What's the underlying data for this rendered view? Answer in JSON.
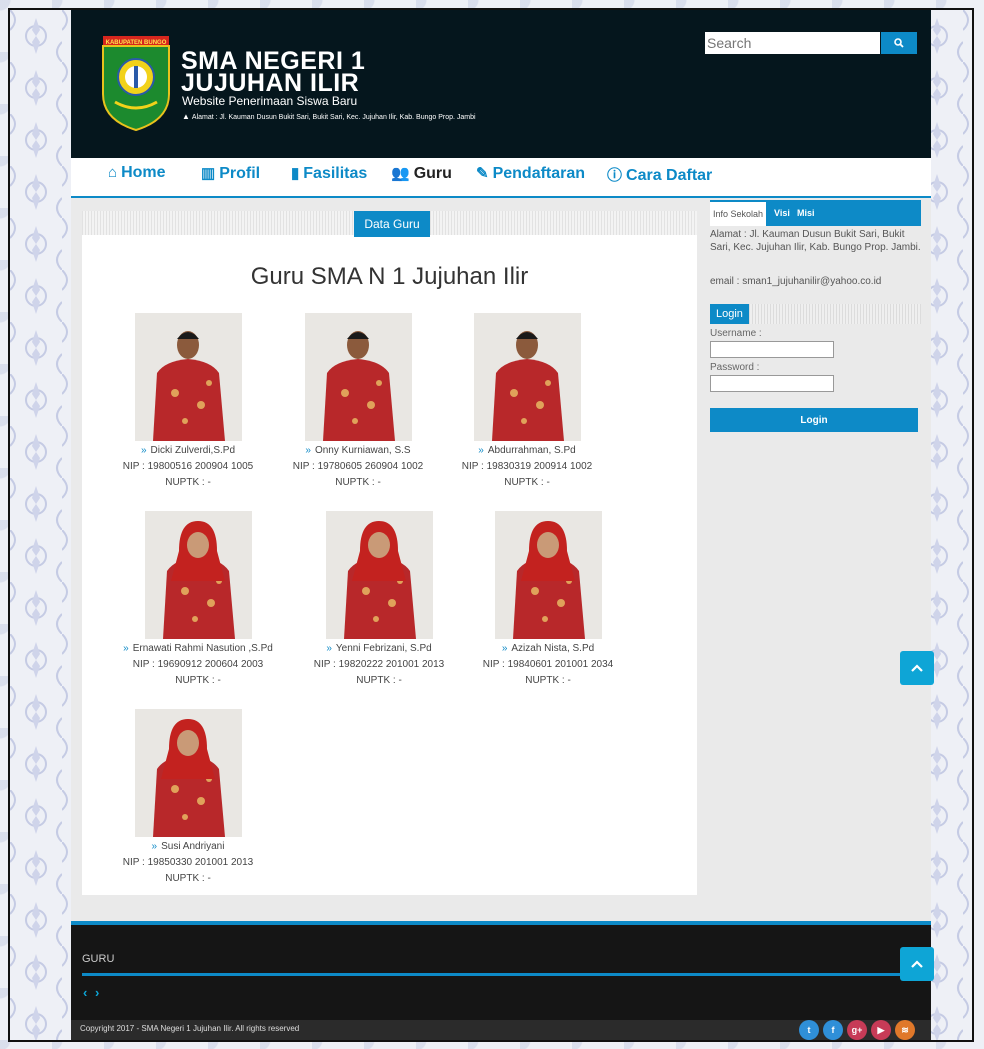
{
  "header": {
    "title_line1": "SMA NEGERI 1",
    "title_line2": "JUJUHAN ILIR",
    "subtitle": "Website Penerimaan Siswa Baru",
    "address": "Alamat : Jl. Kauman Dusun Bukit Sari, Bukit Sari, Kec. Jujuhan Ilir, Kab. Bungo Prop. Jambi",
    "logo_text": "KABUPATEN BUNGO",
    "search_placeholder": "Search",
    "search_icon": "search-icon"
  },
  "nav": [
    {
      "label": "Home",
      "icon": "home-icon",
      "active": false
    },
    {
      "label": "Profil",
      "icon": "institution-icon",
      "active": false
    },
    {
      "label": "Fasilitas",
      "icon": "bookmark-icon",
      "active": false
    },
    {
      "label": "Guru",
      "icon": "users-icon",
      "active": true
    },
    {
      "label": "Pendaftaran",
      "icon": "edit-icon",
      "active": false
    },
    {
      "label": "Cara Daftar",
      "icon": "info-icon",
      "active": false
    }
  ],
  "main": {
    "tab_label": "Data Guru",
    "title": "Guru SMA N 1 Jujuhan Ilir",
    "teachers": [
      {
        "name": "Dicki Zulverdi,S.Pd",
        "nip": "NIP : 19800516 200904 1005",
        "nuptk": "NUPTK : -",
        "gender": "male"
      },
      {
        "name": "Onny Kurniawan, S.S",
        "nip": "NIP : 19780605 260904 1002",
        "nuptk": "NUPTK : -",
        "gender": "male"
      },
      {
        "name": "Abdurrahman, S.Pd",
        "nip": "NIP : 19830319 200914 1002",
        "nuptk": "NUPTK : -",
        "gender": "male"
      },
      {
        "name": "Ernawati Rahmi Nasution ,S.Pd",
        "nip": "NIP : 19690912 200604 2003",
        "nuptk": "NUPTK : -",
        "gender": "female"
      },
      {
        "name": "Yenni Febrizani, S.Pd",
        "nip": "NIP : 19820222 201001 2013",
        "nuptk": "NUPTK : -",
        "gender": "female"
      },
      {
        "name": "Azizah Nista, S.Pd",
        "nip": "NIP : 19840601 201001 2034",
        "nuptk": "NUPTK : -",
        "gender": "female"
      },
      {
        "name": "Susi Andriyani",
        "nip": "NIP : 19850330 201001 2013",
        "nuptk": "NUPTK : -",
        "gender": "female"
      }
    ]
  },
  "sidebar": {
    "tabs": [
      "Info Sekolah",
      "Visi",
      "Misi"
    ],
    "info_text": "Alamat : Jl. Kauman Dusun Bukit Sari, Bukit Sari, Kec. Jujuhan Ilir, Kab. Bungo Prop. Jambi.",
    "email_text": "email : sman1_jujuhanilir@yahoo.co.id",
    "login_title": "Login",
    "username_label": "Username :",
    "password_label": "Password :",
    "login_button": "Login"
  },
  "footer": {
    "title": "GURU",
    "copyright": "Copyright 2017 - SMA Negeri 1 Jujuhan Ilir. All rights reserved",
    "social": [
      {
        "icon": "twitter-icon",
        "glyph": "t",
        "color": "#2f8fd8"
      },
      {
        "icon": "facebook-icon",
        "glyph": "f",
        "color": "#2f8fd8"
      },
      {
        "icon": "google-plus-icon",
        "glyph": "g+",
        "color": "#c73b57"
      },
      {
        "icon": "youtube-icon",
        "glyph": "▶",
        "color": "#c73b57"
      },
      {
        "icon": "rss-icon",
        "glyph": "≋",
        "color": "#e0782a"
      }
    ]
  },
  "colors": {
    "accent": "#0d8ac7",
    "header_bg": "#05161d",
    "footer_bg": "#151515",
    "shirt": "#b8282a",
    "hijab": "#c3221f"
  }
}
